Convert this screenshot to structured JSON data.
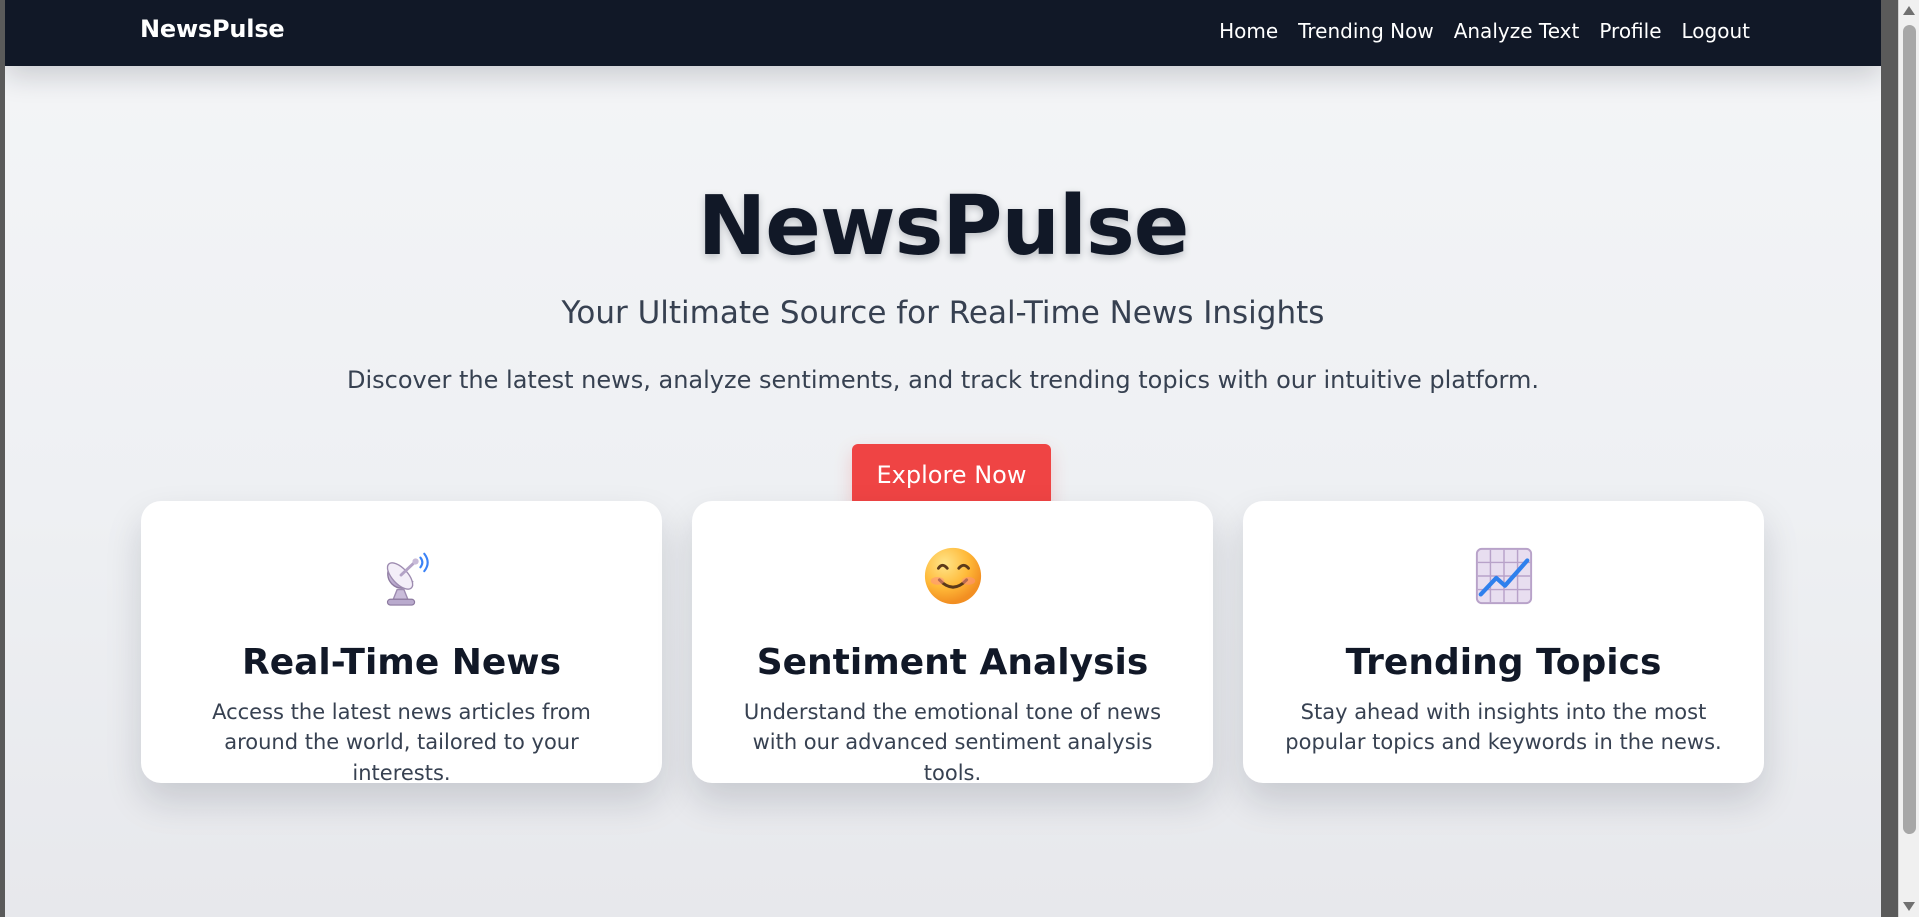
{
  "header": {
    "brand": "NewsPulse",
    "nav": [
      {
        "label": "Home"
      },
      {
        "label": "Trending Now"
      },
      {
        "label": "Analyze Text"
      },
      {
        "label": "Profile"
      },
      {
        "label": "Logout"
      }
    ]
  },
  "hero": {
    "title": "NewsPulse",
    "subtitle": "Your Ultimate Source for Real-Time News Insights",
    "description": "Discover the latest news, analyze sentiments, and track trending topics with our intuitive platform.",
    "cta_label": "Explore Now"
  },
  "features": [
    {
      "icon": "satellite-dish-icon",
      "title": "Real-Time News",
      "description": "Access the latest news articles from around the world, tailored to your interests."
    },
    {
      "icon": "smiling-face-icon",
      "title": "Sentiment Analysis",
      "description": "Understand the emotional tone of news with our advanced sentiment analysis tools."
    },
    {
      "icon": "trend-chart-icon",
      "title": "Trending Topics",
      "description": "Stay ahead with insights into the most popular topics and keywords in the news."
    }
  ],
  "colors": {
    "navbar": "#111827",
    "text_primary": "#111827",
    "text_secondary": "#374151",
    "accent": "#ef4444",
    "card": "#ffffff"
  }
}
